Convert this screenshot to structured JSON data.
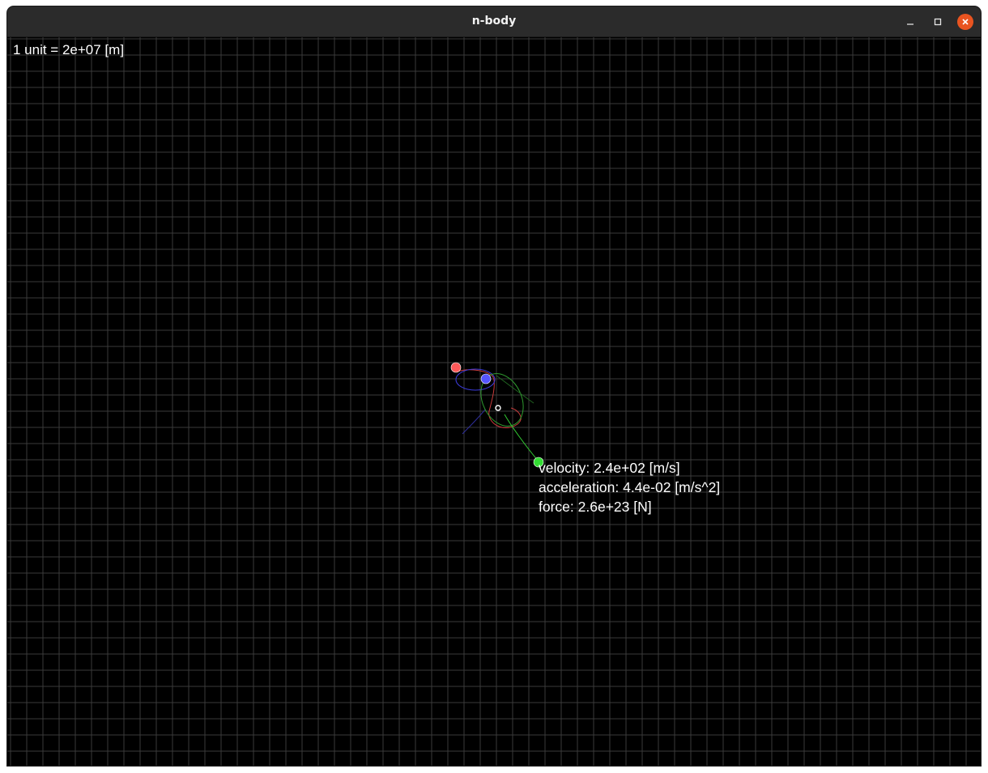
{
  "window": {
    "title": "n-body",
    "controls": {
      "minimize_icon": "minimize-icon",
      "maximize_icon": "maximize-icon",
      "close_icon": "close-icon",
      "close_color": "#e95420"
    }
  },
  "viewport": {
    "scale_label": "1 unit = 2e+07 [m]",
    "background_color": "#000000",
    "grid_color": "#3a3a3a"
  },
  "bodies": [
    {
      "id": "red",
      "color": "#ff5a5a"
    },
    {
      "id": "blue",
      "color": "#5555ff"
    },
    {
      "id": "green",
      "color": "#33dd33"
    },
    {
      "id": "center",
      "color": "#ffffff"
    }
  ],
  "selected_body": {
    "id": "green",
    "velocity": "velocity: 2.4e+02 [m/s]",
    "acceleration": "acceleration: 4.4e-02 [m/s^2]",
    "force": "force: 2.6e+23 [N]"
  }
}
